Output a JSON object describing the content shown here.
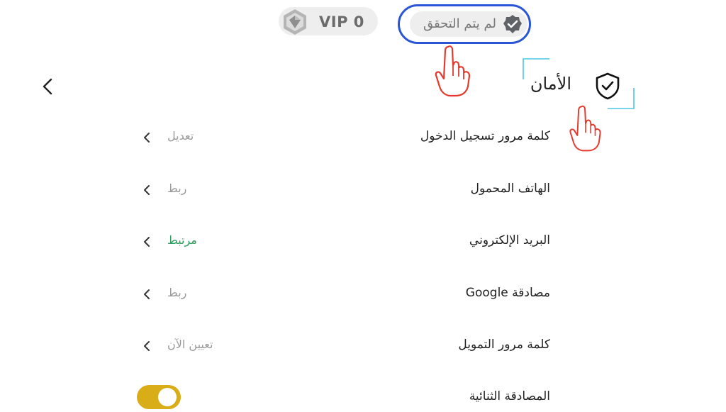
{
  "header": {
    "vip_label": "VIP 0",
    "verification_status": "لم يتم التحقق"
  },
  "section": {
    "title": "الأمان"
  },
  "settings": [
    {
      "label": "كلمة مرور تسجيل الدخول",
      "value": "تعديل",
      "status": "muted"
    },
    {
      "label": "الهاتف المحمول",
      "value": "ربط",
      "status": "muted"
    },
    {
      "label": "البريد الإلكتروني",
      "value": "مرتبط",
      "status": "linked"
    },
    {
      "label": "مصادقة Google",
      "value": "ربط",
      "status": "muted"
    },
    {
      "label": "كلمة مرور التمويل",
      "value": "تعيين الآن",
      "status": "muted"
    }
  ],
  "two_factor": {
    "label": "المصادقة الثنائية",
    "enabled": true
  },
  "colors": {
    "toggle_on": "#d9ad18",
    "linked_text": "#2e9c5e",
    "highlight_border": "#2a55d6",
    "annotation_frame": "#4cc6e0",
    "hand_outline": "#e23b2e"
  }
}
